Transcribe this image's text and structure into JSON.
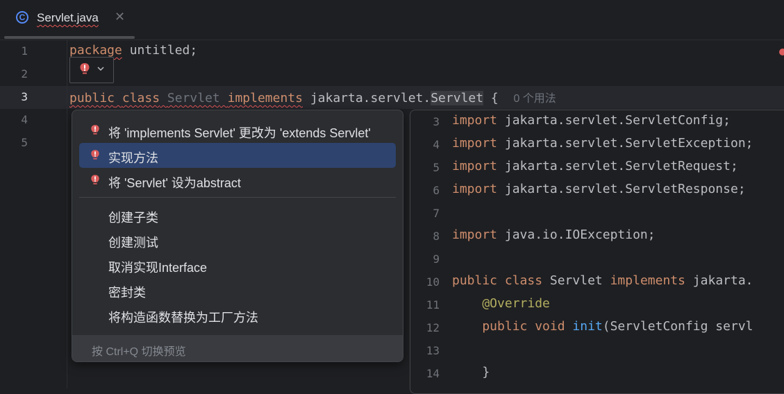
{
  "tab": {
    "title": "Servlet.java",
    "close": "✕",
    "file_icon_letter": "C"
  },
  "editor": {
    "line_numbers": [
      "1",
      "2",
      "3",
      "4",
      "5"
    ],
    "line1": {
      "kw": "package",
      "rest": " untitled;"
    },
    "line3": {
      "kw1": "public",
      "kw2": "class",
      "name": "Servlet",
      "kw3": "implements",
      "pkg": " jakarta.servlet.",
      "iface": "Servlet",
      "brace": " {",
      "usages": "0 个用法"
    }
  },
  "popup": {
    "items": [
      {
        "label": "将 'implements Servlet' 更改为 'extends Servlet'",
        "icon": "error-bulb-icon"
      },
      {
        "label": "实现方法",
        "icon": "error-bulb-icon",
        "selected": true
      },
      {
        "label": "将 'Servlet' 设为abstract",
        "icon": "error-bulb-icon"
      },
      {
        "label": "创建子类"
      },
      {
        "label": "创建测试"
      },
      {
        "label": "取消实现Interface"
      },
      {
        "label": "密封类"
      },
      {
        "label": "将构造函数替换为工厂方法"
      }
    ],
    "footer": "按 Ctrl+Q 切换预览"
  },
  "preview": {
    "lines": [
      {
        "n": "3",
        "kw": "import",
        "rest": " jakarta.servlet.ServletConfig;"
      },
      {
        "n": "4",
        "kw": "import",
        "rest": " jakarta.servlet.ServletException;"
      },
      {
        "n": "5",
        "kw": "import",
        "rest": " jakarta.servlet.ServletRequest;"
      },
      {
        "n": "6",
        "kw": "import",
        "rest": " jakarta.servlet.ServletResponse;"
      },
      {
        "n": "7",
        "kw": "",
        "rest": ""
      },
      {
        "n": "8",
        "kw": "import",
        "rest": " java.io.IOException;"
      },
      {
        "n": "9",
        "kw": "",
        "rest": ""
      },
      {
        "n": "10",
        "kw": "public class",
        "rest": " Servlet ",
        "kw2": "implements",
        "rest2": " jakarta."
      },
      {
        "n": "11",
        "ann": "    @Override"
      },
      {
        "n": "12",
        "kw": "    public void",
        "fn": " init",
        "rest": "(ServletConfig servl"
      },
      {
        "n": "13",
        "kw": "",
        "rest": ""
      },
      {
        "n": "14",
        "kw": "",
        "rest": "    }"
      }
    ]
  },
  "colors": {
    "keyword": "#cf8e6d",
    "error": "#db5c5c",
    "selection": "#2e436e",
    "accent": "#548af7"
  }
}
